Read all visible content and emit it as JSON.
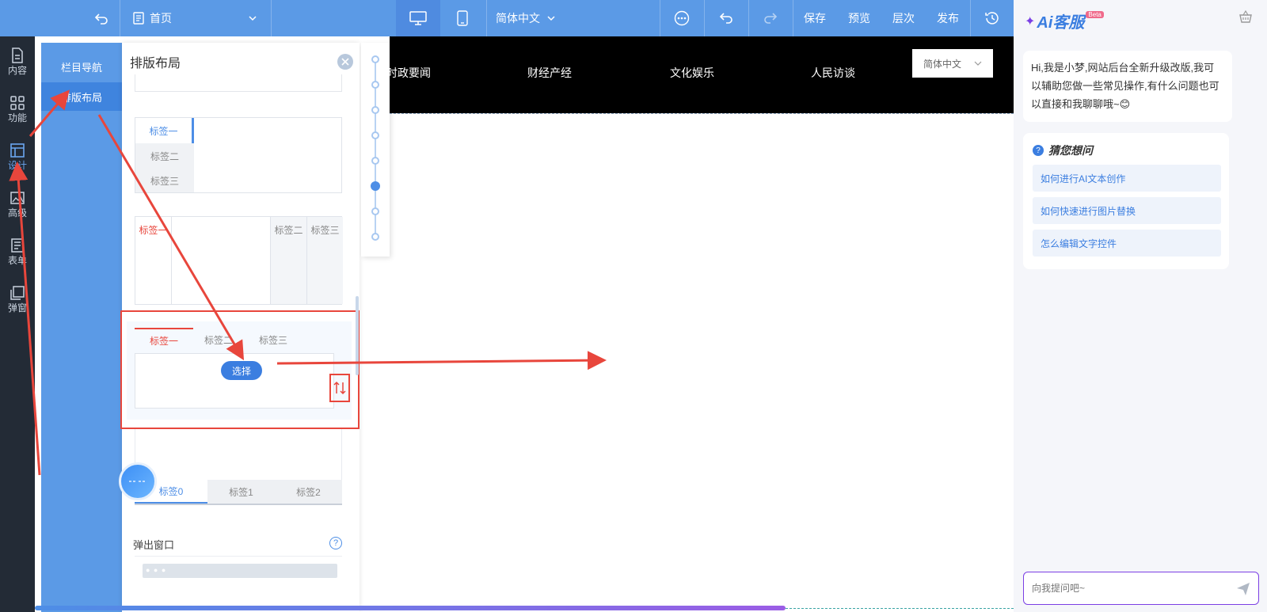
{
  "toolbar": {
    "page_select": "首页",
    "language_select": "简体中文",
    "save": "保存",
    "preview": "预览",
    "layers": "层次",
    "publish": "发布"
  },
  "rail": {
    "items": [
      "内容",
      "功能",
      "设计",
      "高级",
      "表单",
      "弹窗"
    ]
  },
  "nav": {
    "items": [
      "栏目导航",
      "排版布局"
    ]
  },
  "panel": {
    "title": "排版布局",
    "vtab": [
      "标签一",
      "标签二",
      "标签三"
    ],
    "htab2": [
      "标签一",
      "标签二",
      "标签三"
    ],
    "htab3": [
      "标签一",
      "标签二",
      "标签三"
    ],
    "select_button": "选择",
    "htab4": [
      "标签0",
      "标签1",
      "标签2"
    ],
    "popup_section": "弹出窗口"
  },
  "canvas": {
    "nav_items": [
      "时政要闻",
      "财经产经",
      "文化娱乐",
      "人民访谈"
    ],
    "language": "简体中文"
  },
  "ai": {
    "logo": "Ai客服",
    "beta": "Beta",
    "greeting": "Hi,我是小梦,网站后台全新升级改版,我可以辅助您做一些常见操作,有什么问题也可以直接和我聊聊哦~😊",
    "guess_title": "猜您想问",
    "suggestions": [
      "如何进行AI文本创作",
      "如何快速进行图片替换",
      "怎么编辑文字控件"
    ],
    "input_placeholder": "向我提问吧~"
  },
  "colors": {
    "toolbar": "#5b9ae6",
    "rail": "#232b36",
    "accent": "#3b7ee0",
    "ai_accent": "#7b3fe4",
    "highlight": "#e8463c"
  }
}
